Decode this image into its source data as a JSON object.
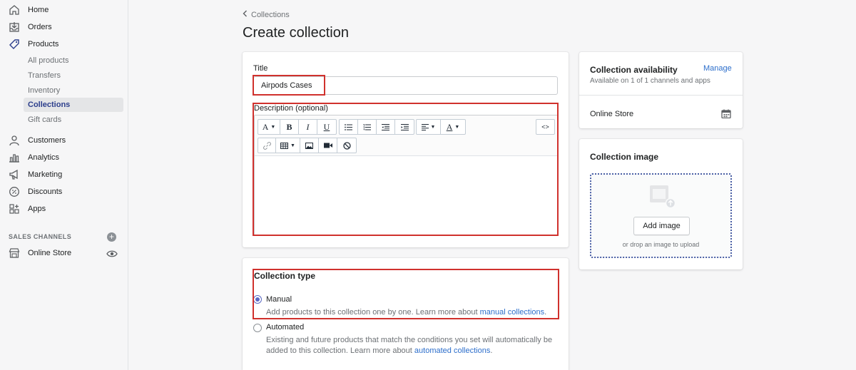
{
  "sidebar": {
    "nav": [
      {
        "label": "Home",
        "icon": "home-icon"
      },
      {
        "label": "Orders",
        "icon": "orders-icon"
      },
      {
        "label": "Products",
        "icon": "tag-icon"
      }
    ],
    "products_sub": [
      {
        "label": "All products"
      },
      {
        "label": "Transfers"
      },
      {
        "label": "Inventory"
      },
      {
        "label": "Collections",
        "active": true
      },
      {
        "label": "Gift cards"
      }
    ],
    "nav2": [
      {
        "label": "Customers",
        "icon": "person-icon"
      },
      {
        "label": "Analytics",
        "icon": "analytics-icon"
      },
      {
        "label": "Marketing",
        "icon": "megaphone-icon"
      },
      {
        "label": "Discounts",
        "icon": "discount-icon"
      },
      {
        "label": "Apps",
        "icon": "apps-icon"
      }
    ],
    "sales_channels_label": "SALES CHANNELS",
    "online_store": "Online Store"
  },
  "breadcrumb": "Collections",
  "page_title": "Create collection",
  "form": {
    "title_label": "Title",
    "title_value": "Airpods Cases",
    "description_label": "Description (optional)",
    "toolbar_row1": [
      "A",
      "B",
      "I",
      "U",
      "bullet-list",
      "numbered-list",
      "outdent",
      "indent",
      "align",
      "text-color"
    ],
    "html_toggle": "<>"
  },
  "collection_type": {
    "title": "Collection type",
    "manual_label": "Manual",
    "manual_help": "Add products to this collection one by one. Learn more about ",
    "manual_link": "manual collections",
    "manual_help_end": ".",
    "automated_label": "Automated",
    "automated_help": "Existing and future products that match the conditions you set will automatically be added to this collection. Learn more about ",
    "automated_link": "automated collections",
    "automated_help_end": ".",
    "selected": "Manual"
  },
  "availability": {
    "title": "Collection availability",
    "manage": "Manage",
    "subtitle": "Available on 1 of 1 channels and apps",
    "channel": "Online Store"
  },
  "image": {
    "title": "Collection image",
    "button": "Add image",
    "drop_text": "or drop an image to upload"
  },
  "colors": {
    "accent": "#5c6ac4",
    "link": "#2c6ecb",
    "annotation": "#d0312d",
    "active_nav": "#2c3e8c"
  }
}
